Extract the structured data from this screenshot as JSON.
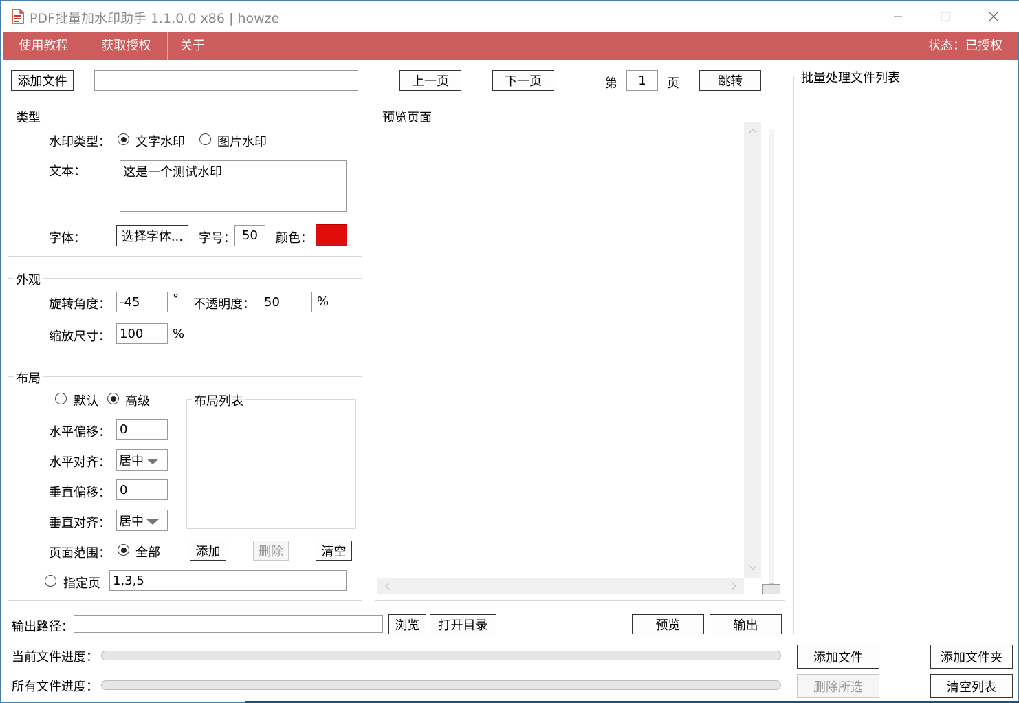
{
  "window": {
    "title": "PDF批量加水印助手 1.1.0.0 x86 | howze"
  },
  "menu": {
    "items": [
      "使用教程",
      "获取授权",
      "关于"
    ],
    "status": "状态：已授权"
  },
  "toolbar": {
    "add_file": "添加文件",
    "file_path": "",
    "prev_page": "上一页",
    "next_page": "下一页",
    "page_prefix": "第",
    "page_value": "1",
    "page_suffix": "页",
    "jump": "跳转"
  },
  "type_group": {
    "title": "类型",
    "watermark_type_label": "水印类型：",
    "text_option": "文字水印",
    "image_option": "图片水印",
    "selected": "text",
    "text_label": "文本：",
    "text_value": "这是一个测试水印",
    "font_label": "字体：",
    "choose_font": "选择字体...",
    "size_label": "字号：",
    "size_value": "50",
    "color_label": "颜色：",
    "color_value": "#e00b0b"
  },
  "appearance_group": {
    "title": "外观",
    "rotation_label": "旋转角度：",
    "rotation_value": "-45",
    "degree_unit": "°",
    "opacity_label": "不透明度：",
    "opacity_value": "50",
    "percent_unit": "%",
    "scale_label": "缩放尺寸：",
    "scale_value": "100"
  },
  "layout_group": {
    "title": "布局",
    "default_option": "默认",
    "advanced_option": "高级",
    "selected": "advanced",
    "h_offset_label": "水平偏移：",
    "h_offset_value": "0",
    "h_align_label": "水平对齐：",
    "h_align_value": "居中",
    "v_offset_label": "垂直偏移：",
    "v_offset_value": "0",
    "v_align_label": "垂直对齐：",
    "v_align_value": "居中",
    "layout_list_title": "布局列表",
    "page_range_label": "页面范围：",
    "all_pages_option": "全部",
    "add_button": "添加",
    "delete_button": "删除",
    "clear_button": "清空",
    "specific_pages_option": "指定页",
    "specific_pages_value": "1,3,5"
  },
  "preview": {
    "title": "预览页面"
  },
  "output": {
    "path_label": "输出路径：",
    "path_value": "",
    "browse": "浏览",
    "open_dir": "打开目录",
    "preview": "预览",
    "export": "输出"
  },
  "progress": {
    "current_label": "当前文件进度：",
    "current_value": 0,
    "all_label": "所有文件进度：",
    "all_value": 0
  },
  "batch": {
    "title": "批量处理文件列表",
    "add_file": "添加文件",
    "add_folder": "添加文件夹",
    "delete_selected": "删除所选",
    "clear_list": "清空列表"
  }
}
